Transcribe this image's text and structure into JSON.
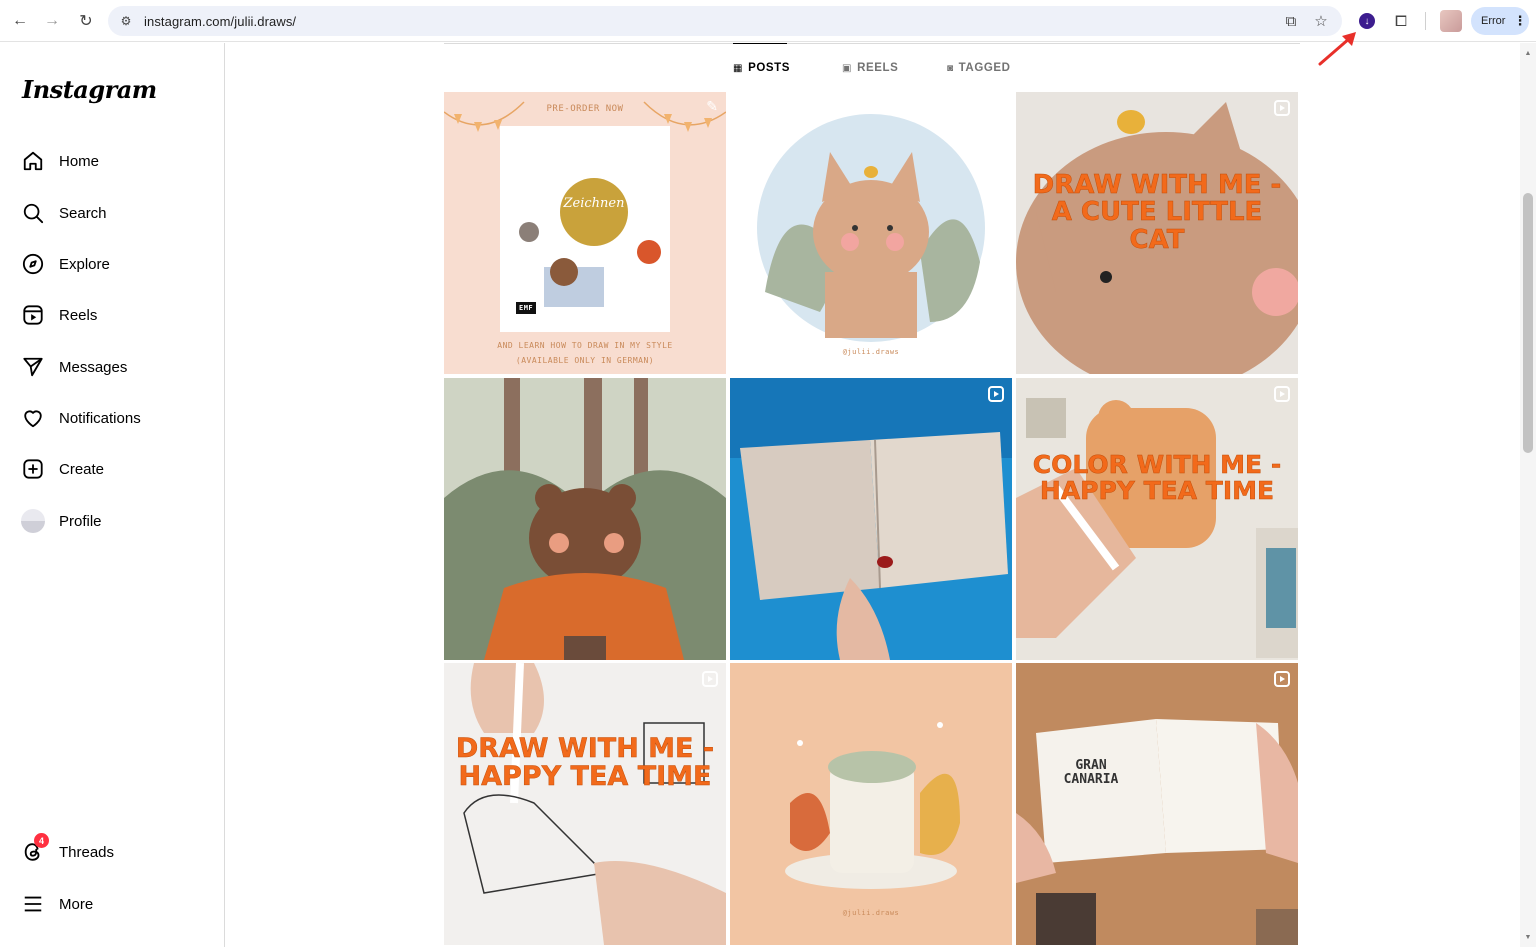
{
  "browser": {
    "url": "instagram.com/julii.draws/",
    "error_label": "Error"
  },
  "sidebar": {
    "logo": "Instagram",
    "items": [
      {
        "label": "Home"
      },
      {
        "label": "Search"
      },
      {
        "label": "Explore"
      },
      {
        "label": "Reels"
      },
      {
        "label": "Messages"
      },
      {
        "label": "Notifications"
      },
      {
        "label": "Create"
      },
      {
        "label": "Profile"
      }
    ],
    "threads": {
      "label": "Threads",
      "badge": "4"
    },
    "more": {
      "label": "More"
    }
  },
  "profile_tabs": [
    {
      "label": "POSTS",
      "icon": "grid-icon",
      "active": true
    },
    {
      "label": "REELS",
      "icon": "reels-icon",
      "active": false
    },
    {
      "label": "TAGGED",
      "icon": "tagged-icon",
      "active": false
    }
  ],
  "posts": [
    {
      "caption_top": "PRE-ORDER NOW",
      "caption_bottom": "AND LEARN HOW TO DRAW IN MY STYLE",
      "caption_sub": "(AVAILABLE ONLY IN GERMAN)",
      "book_title": "Zeichnen",
      "book_publisher": "EMF",
      "type": "pinned"
    },
    {
      "signature": "@julii.draws",
      "type": "post"
    },
    {
      "caption": "DRAW WITH ME - A CUTE LITTLE CAT",
      "type": "reel"
    },
    {
      "type": "post"
    },
    {
      "type": "reel"
    },
    {
      "caption": "COLOR WITH ME - HAPPY TEA TIME",
      "type": "reel"
    },
    {
      "caption": "DRAW WITH ME - HAPPY TEA TIME",
      "type": "reel"
    },
    {
      "signature": "@julii.draws",
      "type": "post"
    },
    {
      "caption": "GRAN CANARIA",
      "type": "reel"
    }
  ],
  "colors": {
    "accent_orange": "#f26a1b",
    "badge_red": "#ff3040",
    "annotation_red": "#e8302a"
  }
}
